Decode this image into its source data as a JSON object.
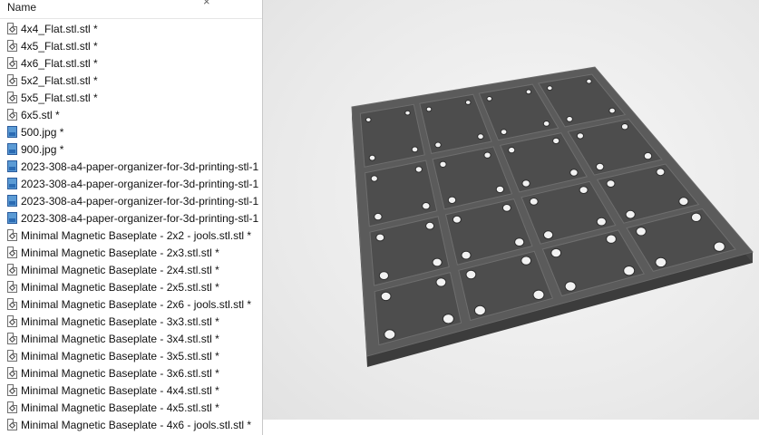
{
  "explorer": {
    "column_header": "Name",
    "close_glyph": "×",
    "files": [
      {
        "name": "4x4_Flat.stl.stl *",
        "icon": "stl-file-icon"
      },
      {
        "name": "4x5_Flat.stl.stl *",
        "icon": "stl-file-icon"
      },
      {
        "name": "4x6_Flat.stl.stl *",
        "icon": "stl-file-icon"
      },
      {
        "name": "5x2_Flat.stl.stl *",
        "icon": "stl-file-icon"
      },
      {
        "name": "5x5_Flat.stl.stl *",
        "icon": "stl-file-icon"
      },
      {
        "name": "6x5.stl *",
        "icon": "stl-file-icon"
      },
      {
        "name": "500.jpg *",
        "icon": "image-file-icon"
      },
      {
        "name": "900.jpg *",
        "icon": "image-file-icon"
      },
      {
        "name": "2023-308-a4-paper-organizer-for-3d-printing-stl-1",
        "icon": "image-file-icon"
      },
      {
        "name": "2023-308-a4-paper-organizer-for-3d-printing-stl-1",
        "icon": "image-file-icon"
      },
      {
        "name": "2023-308-a4-paper-organizer-for-3d-printing-stl-1",
        "icon": "image-file-icon"
      },
      {
        "name": "2023-308-a4-paper-organizer-for-3d-printing-stl-1",
        "icon": "image-file-icon"
      },
      {
        "name": "Minimal Magnetic Baseplate - 2x2 - jools.stl.stl *",
        "icon": "stl-file-icon"
      },
      {
        "name": "Minimal Magnetic Baseplate - 2x3.stl.stl *",
        "icon": "stl-file-icon"
      },
      {
        "name": "Minimal Magnetic Baseplate - 2x4.stl.stl *",
        "icon": "stl-file-icon"
      },
      {
        "name": "Minimal Magnetic Baseplate - 2x5.stl.stl *",
        "icon": "stl-file-icon"
      },
      {
        "name": "Minimal Magnetic Baseplate - 2x6 - jools.stl.stl *",
        "icon": "stl-file-icon"
      },
      {
        "name": "Minimal Magnetic Baseplate - 3x3.stl.stl *",
        "icon": "stl-file-icon"
      },
      {
        "name": "Minimal Magnetic Baseplate - 3x4.stl.stl *",
        "icon": "stl-file-icon"
      },
      {
        "name": "Minimal Magnetic Baseplate - 3x5.stl.stl *",
        "icon": "stl-file-icon"
      },
      {
        "name": "Minimal Magnetic Baseplate - 3x6.stl.stl *",
        "icon": "stl-file-icon"
      },
      {
        "name": "Minimal Magnetic Baseplate - 4x4.stl.stl *",
        "icon": "stl-file-icon"
      },
      {
        "name": "Minimal Magnetic Baseplate - 4x5.stl.stl *",
        "icon": "stl-file-icon"
      },
      {
        "name": "Minimal Magnetic Baseplate - 4x6 - jools.stl.stl *",
        "icon": "stl-file-icon"
      }
    ]
  },
  "viewer": {
    "model_grid": {
      "columns": 4,
      "rows": 4
    },
    "colors": {
      "background": "#ececec",
      "model_top": "#5b5b5b",
      "model_side": "#3c3c3c",
      "cell": "#4d4d4d",
      "hole": "#f2f2f2"
    }
  }
}
